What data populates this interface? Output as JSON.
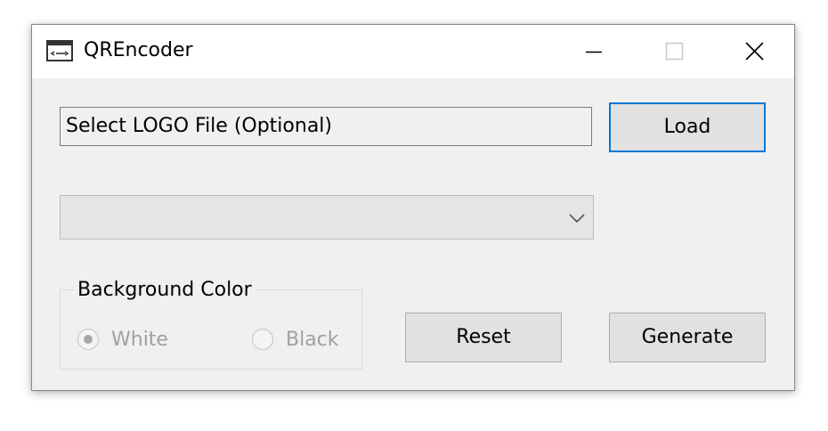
{
  "window": {
    "title": "QREncoder",
    "icon": "console-window-icon"
  },
  "caption_buttons": {
    "minimize": "minimize-icon",
    "maximize": "maximize-icon",
    "close": "close-icon"
  },
  "logo": {
    "field_text": "Select LOGO File (Optional)",
    "load_label": "Load"
  },
  "combo": {
    "selected": "",
    "arrow_icon": "chevron-down-icon"
  },
  "background_color": {
    "legend": "Background Color",
    "options": [
      {
        "label": "White",
        "selected": true
      },
      {
        "label": "Black",
        "selected": false
      }
    ],
    "enabled": false
  },
  "actions": {
    "reset_label": "Reset",
    "generate_label": "Generate"
  },
  "colors": {
    "focus_border": "#0078d7",
    "window_bg": "#f0f0f0",
    "button_bg": "#e1e1e1",
    "disabled_text": "#a0a0a0"
  }
}
